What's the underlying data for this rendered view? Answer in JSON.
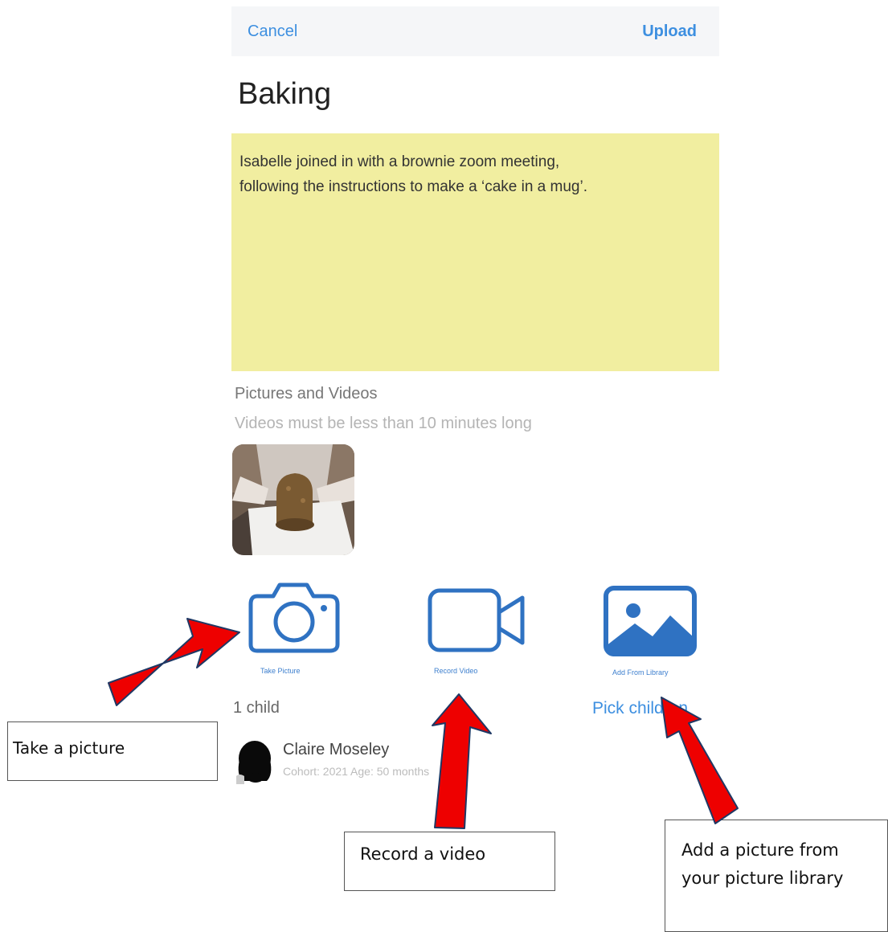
{
  "navbar": {
    "cancel_label": "Cancel",
    "upload_label": "Upload"
  },
  "title": "Baking",
  "note": {
    "line1": "Isabelle joined in with a brownie zoom meeting,",
    "line2": "following the instructions to make a ‘cake in a mug’."
  },
  "media": {
    "section_title": "Pictures and Videos",
    "section_subtitle": "Videos must be less than 10 minutes long"
  },
  "actions": {
    "take_picture": {
      "label": "Take Picture",
      "icon": "camera-icon"
    },
    "record_video": {
      "label": "Record Video",
      "icon": "video-camera-icon"
    },
    "add_from_library": {
      "label": "Add From Library",
      "icon": "image-icon"
    }
  },
  "children": {
    "count_label": "1 child",
    "pick_label": "Pick children",
    "list": [
      {
        "name": "Claire Moseley",
        "meta": "Cohort: 2021 Age: 50 months"
      }
    ]
  },
  "annotations": {
    "take_picture": "Take a picture",
    "record_video": "Record a video",
    "library_line1": "Add a picture from",
    "library_line2": "your picture library"
  },
  "colors": {
    "accent": "#3d8fe0",
    "icon": "#2f72c2",
    "note_background": "#f1eea0",
    "arrow_fill": "#ee0000",
    "arrow_stroke": "#1f3864"
  }
}
